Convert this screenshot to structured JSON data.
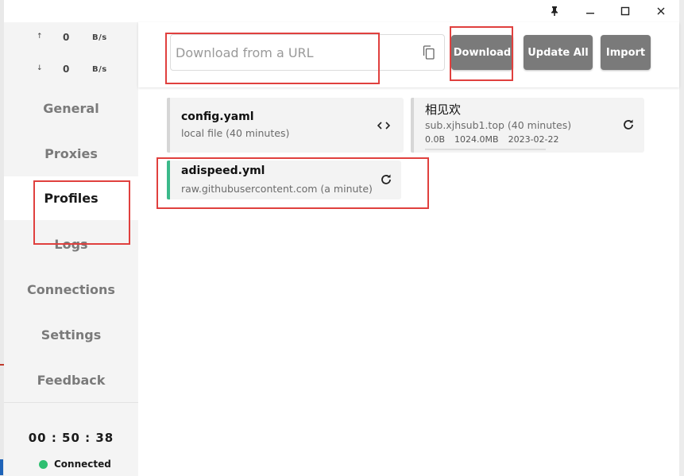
{
  "window": {
    "controls": {
      "pin": "pin-icon",
      "minimize": "minimize-icon",
      "maximize": "maximize-icon",
      "close": "close-icon"
    }
  },
  "traffic": {
    "up": {
      "arrow": "↑",
      "value": "0",
      "unit": "B/s"
    },
    "down": {
      "arrow": "↓",
      "value": "0",
      "unit": "B/s"
    }
  },
  "sidebar": {
    "items": [
      {
        "label": "General"
      },
      {
        "label": "Proxies"
      },
      {
        "label": "Profiles"
      },
      {
        "label": "Logs"
      },
      {
        "label": "Connections"
      },
      {
        "label": "Settings"
      },
      {
        "label": "Feedback"
      }
    ],
    "active": "Profiles",
    "clock": "00 : 50 : 38",
    "status": "Connected",
    "status_color": "#2fbf71"
  },
  "toolbar": {
    "url_placeholder": "Download from a URL",
    "download_label": "Download",
    "update_all_label": "Update All",
    "import_label": "Import",
    "button_color": "#7a7a7a"
  },
  "profiles": [
    {
      "name": "config.yaml",
      "source": "local file (40 minutes)",
      "action_icon": "code-icon"
    },
    {
      "name": "相见欢",
      "source": "sub.xjhsub1.top (40 minutes)",
      "usage_used": "0.0B",
      "usage_total": "1024.0MB",
      "expire": "2023-02-22",
      "action_icon": "refresh-icon"
    },
    {
      "name": "adispeed.yml",
      "source": "raw.githubusercontent.com (a minute)",
      "action_icon": "refresh-icon",
      "selected": true
    }
  ],
  "highlight_color": "#e0403e",
  "active_bar_color": "#3bb98a"
}
